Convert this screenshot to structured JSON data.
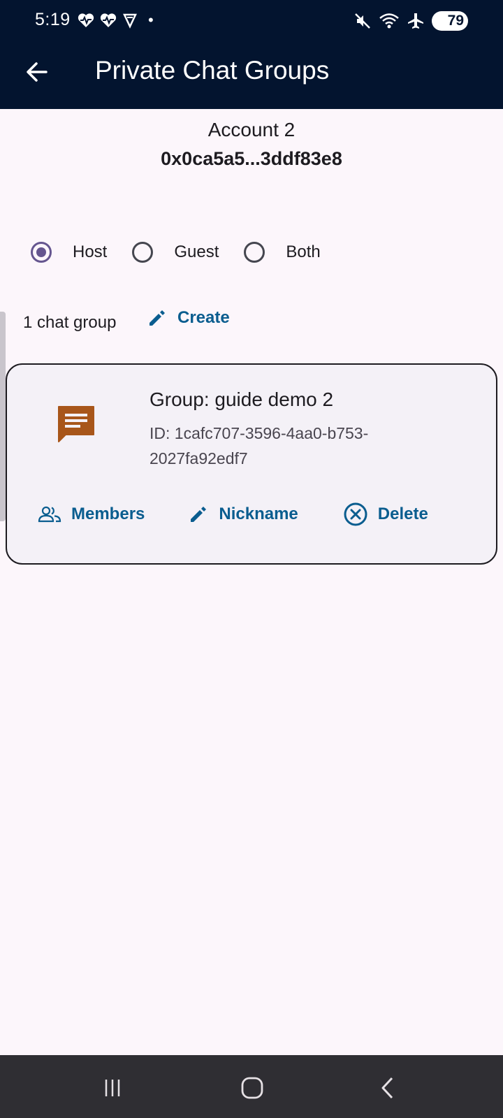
{
  "status_bar": {
    "time": "5:19",
    "dot": "•",
    "battery_level": "79"
  },
  "header": {
    "title": "Private Chat Groups"
  },
  "account": {
    "name": "Account 2",
    "address": "0x0ca5a5...3ddf83e8"
  },
  "role_filter": {
    "options": [
      "Host",
      "Guest",
      "Both"
    ],
    "selected": "Host"
  },
  "groups_toolbar": {
    "count_text": "1 chat group",
    "create_label": "Create"
  },
  "groups": [
    {
      "name": "Group: guide demo 2",
      "id": "ID: 1cafc707-3596-4aa0-b753-2027fa92edf7",
      "actions": {
        "members": "Members",
        "nickname": "Nickname",
        "delete": "Delete"
      }
    }
  ],
  "colors": {
    "top_bar": "#03142f",
    "background": "#fcf6fb",
    "accent_link": "#0a5d8f",
    "radio_selected": "#65558f",
    "chat_icon": "#a8561a"
  }
}
